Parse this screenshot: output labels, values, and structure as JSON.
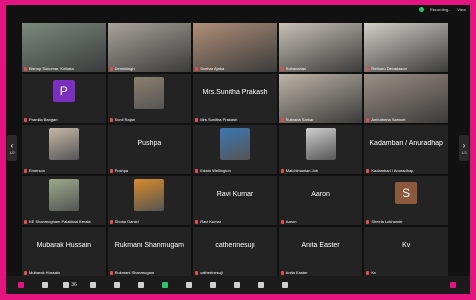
{
  "status": {
    "recording": "Recording...",
    "view": "View"
  },
  "nav": {
    "left_page": "1/2",
    "right_page": "1/2"
  },
  "rows": [
    [
      {
        "name": "Bishop Sukumar, Kolkata",
        "type": "video",
        "bg": "#7a8a7e",
        "active": true
      },
      {
        "name": "Dennisingh",
        "type": "video",
        "bg": "#a8a39a"
      },
      {
        "name": "Snehar Ajaba",
        "type": "video",
        "bg": "#b08f78"
      },
      {
        "name": "Sobanarian",
        "type": "video",
        "bg": "#c7c1b6"
      },
      {
        "name": "Rethuru Devadason",
        "type": "video",
        "bg": "#d2cec8"
      }
    ],
    [
      {
        "name": "Pramila Bangari",
        "type": "avatar",
        "letter": "P",
        "avatarColor": "#7b2fbe"
      },
      {
        "name": "Sunil Rajan",
        "type": "photo",
        "bg": "#8d7f6d"
      },
      {
        "name": "Mrs.Sunitha Prakash",
        "type": "text",
        "big": "Mrs.Sunitha Prakash"
      },
      {
        "name": "Sukrada Sarkar",
        "type": "video",
        "bg": "#bcb4a6"
      },
      {
        "name": "Anbuthena Samuel",
        "type": "video",
        "bg": "#9b8f84"
      }
    ],
    [
      {
        "name": "Emerson",
        "type": "photo",
        "bg": "#c7b8a6"
      },
      {
        "name": "Pushpa",
        "type": "text",
        "big": "Pushpa"
      },
      {
        "name": "Edwin Wellington",
        "type": "photo",
        "bg": "#3a77b2"
      },
      {
        "name": "Malchimanian Job",
        "type": "photo",
        "bg": "#cfcfcf"
      },
      {
        "name": "Kadambari / Anuradhap",
        "type": "text",
        "big": "Kadambari / Anuradhap"
      }
    ],
    [
      {
        "name": "KE Shanmugham Palakkad Kerala",
        "type": "photo",
        "bg": "#9ba98a"
      },
      {
        "name": "Shoba Daniel",
        "type": "photo",
        "bg": "#d98a2b"
      },
      {
        "name": "Ravi Kumar",
        "type": "text",
        "big": "Ravi Kumar"
      },
      {
        "name": "Aaron",
        "type": "text",
        "big": "Aaron"
      },
      {
        "name": "Sheela Lokhande",
        "type": "avatar",
        "letter": "S",
        "avatarColor": "#8b5a3c"
      }
    ],
    [
      {
        "name": "Mubarak Hussain",
        "type": "text",
        "big": "Mubarak Hussain"
      },
      {
        "name": "Rukmani Shanmugam",
        "type": "text",
        "big": "Rukmani Shanmugam"
      },
      {
        "name": "catherinesuji",
        "type": "text",
        "big": "catherinesuji"
      },
      {
        "name": "Anita Easter",
        "type": "text",
        "big": "Anita Easter"
      },
      {
        "name": "Kv",
        "type": "text",
        "big": "Kv"
      }
    ]
  ],
  "toolbar": [
    {
      "name": "mic-button",
      "icon": "mic-icon",
      "label": "",
      "variant": "red"
    },
    {
      "name": "video-button",
      "icon": "video-icon",
      "label": ""
    },
    {
      "name": "participants-button",
      "icon": "participants-icon",
      "label": "36"
    },
    {
      "name": "chat-button",
      "icon": "chat-icon",
      "label": ""
    },
    {
      "name": "react-button",
      "icon": "heart-icon",
      "label": ""
    },
    {
      "name": "raise-hand-button",
      "icon": "hand-icon",
      "label": ""
    },
    {
      "name": "share-button",
      "icon": "share-icon",
      "label": "",
      "variant": "green"
    },
    {
      "name": "security-button",
      "icon": "shield-icon",
      "label": ""
    },
    {
      "name": "ai-button",
      "icon": "sparkle-icon",
      "label": ""
    },
    {
      "name": "record-button",
      "icon": "record-icon",
      "label": ""
    },
    {
      "name": "apps-button",
      "icon": "apps-icon",
      "label": ""
    },
    {
      "name": "more-button",
      "icon": "more-icon",
      "label": ""
    },
    {
      "name": "leave-button",
      "icon": "leave-icon",
      "label": "",
      "variant": "red"
    }
  ]
}
